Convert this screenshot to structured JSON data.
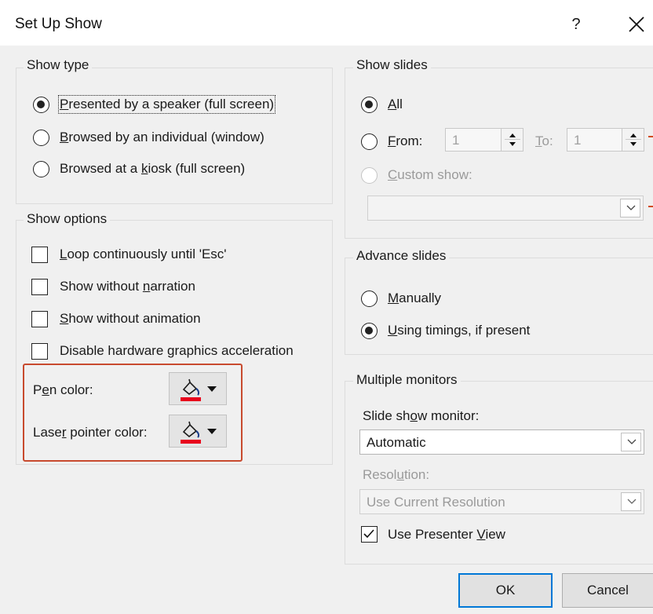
{
  "window": {
    "title": "Set Up Show",
    "help": "?"
  },
  "show_type": {
    "title": "Show type",
    "options": [
      {
        "pre": "",
        "u": "P",
        "post": "resented by a speaker (full screen)",
        "checked": true
      },
      {
        "pre": "",
        "u": "B",
        "post": "rowsed by an individual (window)",
        "checked": false
      },
      {
        "pre": "Browsed at a ",
        "u": "k",
        "post": "iosk (full screen)",
        "checked": false
      }
    ]
  },
  "show_options": {
    "title": "Show options",
    "checks": [
      {
        "pre": "",
        "u": "L",
        "post": "oop continuously until 'Esc'",
        "checked": false
      },
      {
        "pre": "Show without ",
        "u": "n",
        "post": "arration",
        "checked": false
      },
      {
        "pre": "",
        "u": "S",
        "post": "how without animation",
        "checked": false
      },
      {
        "pre": "Disable hardware ",
        "u": "g",
        "post": "raphics acceleration",
        "checked": false
      }
    ],
    "pen_color": {
      "pre": "P",
      "u": "e",
      "post": "n color:",
      "color": "#e8001c"
    },
    "laser_color": {
      "pre": "Lase",
      "u": "r",
      "post": " pointer color:",
      "color": "#e8001c"
    }
  },
  "show_slides": {
    "title": "Show slides",
    "all": {
      "pre": "",
      "u": "A",
      "post": "ll",
      "checked": true
    },
    "from": {
      "pre": "",
      "u": "F",
      "post": "rom:",
      "checked": false,
      "value": "1"
    },
    "to": {
      "pre": "",
      "u": "T",
      "post": "o:",
      "value": "1"
    },
    "custom": {
      "pre": "",
      "u": "C",
      "post": "ustom show:",
      "checked": false,
      "value": ""
    }
  },
  "advance_slides": {
    "title": "Advance slides",
    "manually": {
      "pre": "",
      "u": "M",
      "post": "anually",
      "checked": false
    },
    "timings": {
      "pre": "",
      "u": "U",
      "post": "sing timings, if present",
      "checked": true
    }
  },
  "multiple_monitors": {
    "title": "Multiple monitors",
    "monitor_label": {
      "pre": "Slide sh",
      "u": "o",
      "post": "w monitor:"
    },
    "monitor_value": "Automatic",
    "resolution_label": {
      "pre": "Resol",
      "u": "u",
      "post": "tion:"
    },
    "resolution_value": "Use Current Resolution",
    "presenter_view": {
      "pre": "Use Presenter ",
      "u": "V",
      "post": "iew",
      "checked": true
    }
  },
  "buttons": {
    "ok": "OK",
    "cancel": "Cancel"
  },
  "colors": {
    "annotation_red": "#c84a2e",
    "focus_blue": "#0078d7",
    "dialog_bg": "#f0f0f0"
  }
}
